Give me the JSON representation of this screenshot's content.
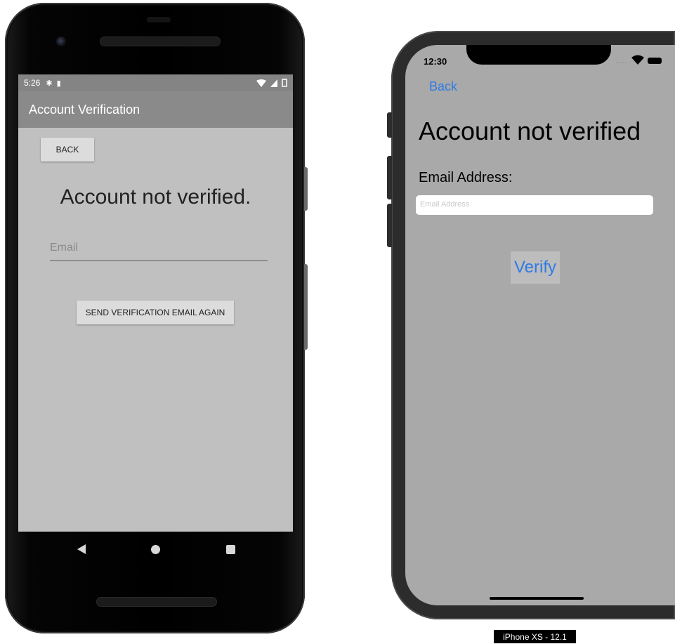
{
  "android": {
    "status_time": "5:26",
    "status_icons": [
      "gear-icon",
      "sd-card-icon",
      "wifi-icon",
      "signal-icon",
      "battery-icon"
    ],
    "appbar_title": "Account Verification",
    "back_button": "BACK",
    "heading": "Account not verified.",
    "email_placeholder": "Email",
    "send_button": "SEND VERIFICATION EMAIL AGAIN",
    "nav": [
      "back-icon",
      "home-icon",
      "recents-icon"
    ]
  },
  "ios": {
    "status_time": "12:30",
    "back_link": "Back",
    "heading": "Account not verified",
    "email_label": "Email Address:",
    "email_placeholder": "Email Address",
    "verify_button": "Verify",
    "accent_color": "#2f7ae5"
  },
  "simulator_label": "iPhone XS - 12.1"
}
